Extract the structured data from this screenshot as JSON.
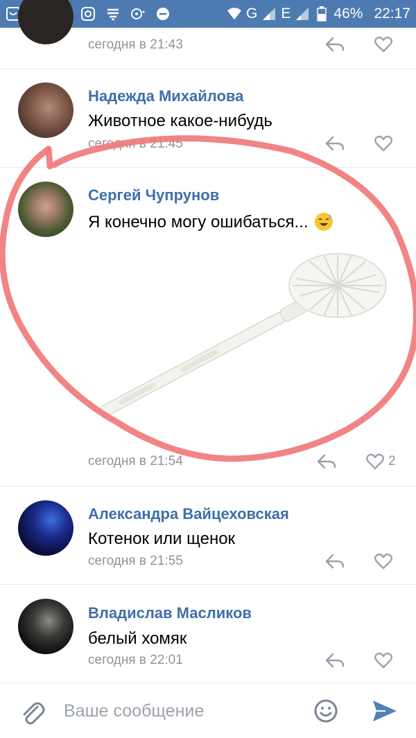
{
  "status_bar": {
    "battery": "46%",
    "time": "22:17",
    "network_1": "G",
    "network_2": "E"
  },
  "comments": [
    {
      "author": "",
      "text": "",
      "time": "сегодня в 21:43"
    },
    {
      "author": "Надежда Михайлова",
      "text": "Животное какое-нибудь",
      "time": "сегодня в 21:45"
    },
    {
      "author": "Сергей Чупрунов",
      "text": "Я конечно могу ошибаться...",
      "time": "сегодня в 21:54",
      "likes": "2",
      "image": "toilet-brush"
    },
    {
      "author": "Александра Вайцеховская",
      "text": "Котенок или щенок",
      "time": "сегодня в 21:55"
    },
    {
      "author": "Владислав Масликов",
      "text": "белый хомяк",
      "time": "сегодня в 22:01"
    }
  ],
  "composer": {
    "placeholder": "Ваше сообщение"
  },
  "colors": {
    "status_bar": "#4d7bb1",
    "author": "#3f6fa8",
    "time": "#939393",
    "accent": "#5181b8",
    "scribble": "#f07a7a"
  },
  "icons": [
    "attach-icon",
    "emoji-icon",
    "send-icon",
    "reply-icon",
    "heart-icon"
  ]
}
